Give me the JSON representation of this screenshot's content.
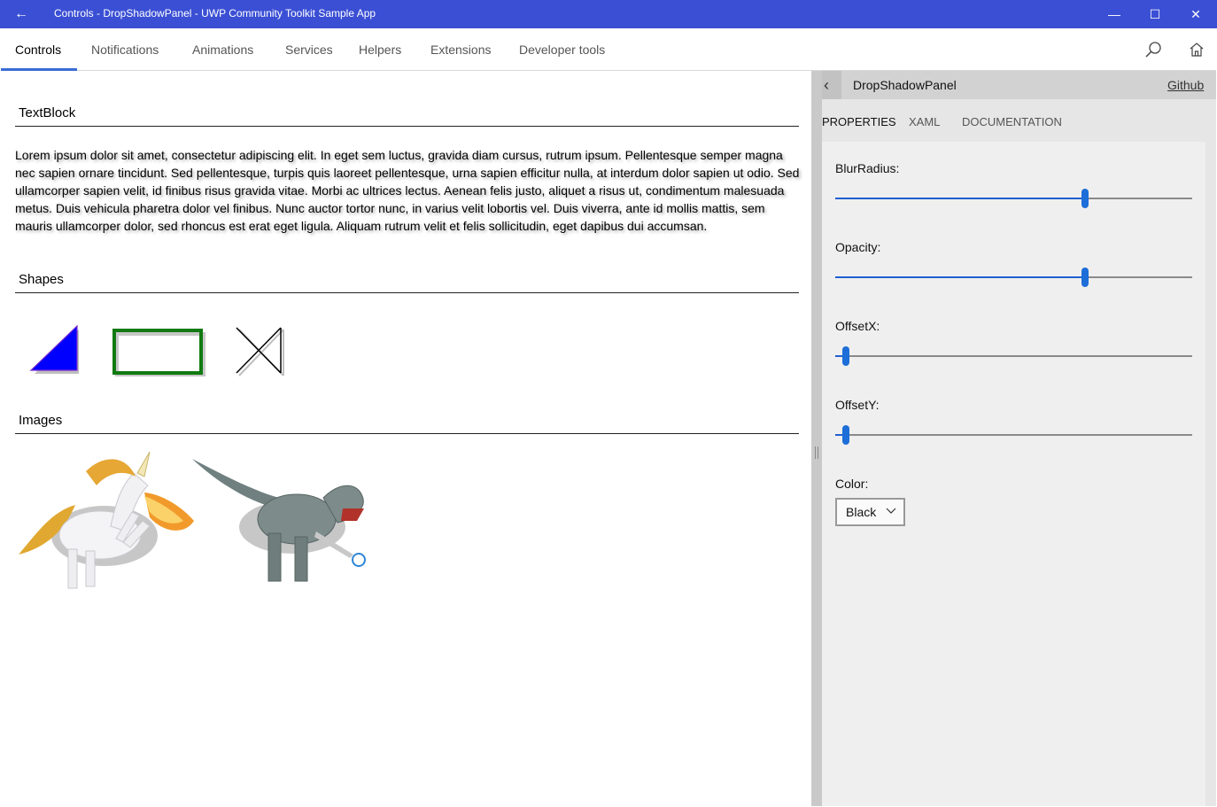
{
  "window": {
    "title": "Controls - DropShadowPanel - UWP Community Toolkit Sample App",
    "back_glyph": "←",
    "minimize_glyph": "—",
    "maximize_glyph": "☐",
    "close_glyph": "✕",
    "accent_color": "#3a4fd4"
  },
  "nav": {
    "items": [
      "Controls",
      "Notifications",
      "Animations",
      "Services",
      "Helpers",
      "Extensions",
      "Developer tools"
    ],
    "active": "Controls",
    "icons": [
      "search-icon",
      "home-icon"
    ]
  },
  "main": {
    "textblock": {
      "heading": "TextBlock",
      "body": "Lorem ipsum dolor sit amet, consectetur adipiscing elit. In eget sem luctus, gravida diam cursus, rutrum ipsum. Pellentesque semper magna nec sapien ornare tincidunt. Sed pellentesque, turpis quis laoreet pellentesque, urna sapien efficitur nulla, at interdum dolor sapien ut odio. Sed ullamcorper sapien velit, id finibus risus gravida vitae. Morbi ac ultrices lectus. Aenean felis justo, aliquet a risus ut, condimentum malesuada metus. Duis vehicula pharetra dolor vel finibus. Nunc auctor tortor nunc, in varius velit lobortis vel. Duis viverra, ante id mollis mattis, sem mauris ullamcorper dolor, sed rhoncus est erat eget ligula. Aliquam rutrum velit et felis sollicitudin, eget dapibus dui accumsan."
    },
    "shapes": {
      "heading": "Shapes",
      "items": [
        "triangle-shape",
        "rectangle-shape",
        "crossed-box-shape"
      ],
      "colors": {
        "triangle": "#0000ff",
        "rectangle": "#117a11",
        "cross": "#000000"
      }
    },
    "images": {
      "heading": "Images",
      "items": [
        "unicorn-image",
        "trex-image"
      ]
    }
  },
  "panel": {
    "back_glyph": "‹",
    "title": "DropShadowPanel",
    "github_link": "Github",
    "tabs": [
      "PROPERTIES",
      "XAML",
      "DOCUMENTATION"
    ],
    "active_tab": "PROPERTIES",
    "properties": [
      {
        "label": "BlurRadius:",
        "value_fraction": 0.7
      },
      {
        "label": "Opacity:",
        "value_fraction": 0.7
      },
      {
        "label": "OffsetX:",
        "value_fraction": 0.03
      },
      {
        "label": "OffsetY:",
        "value_fraction": 0.03
      }
    ],
    "color": {
      "label": "Color:",
      "value": "Black"
    }
  }
}
